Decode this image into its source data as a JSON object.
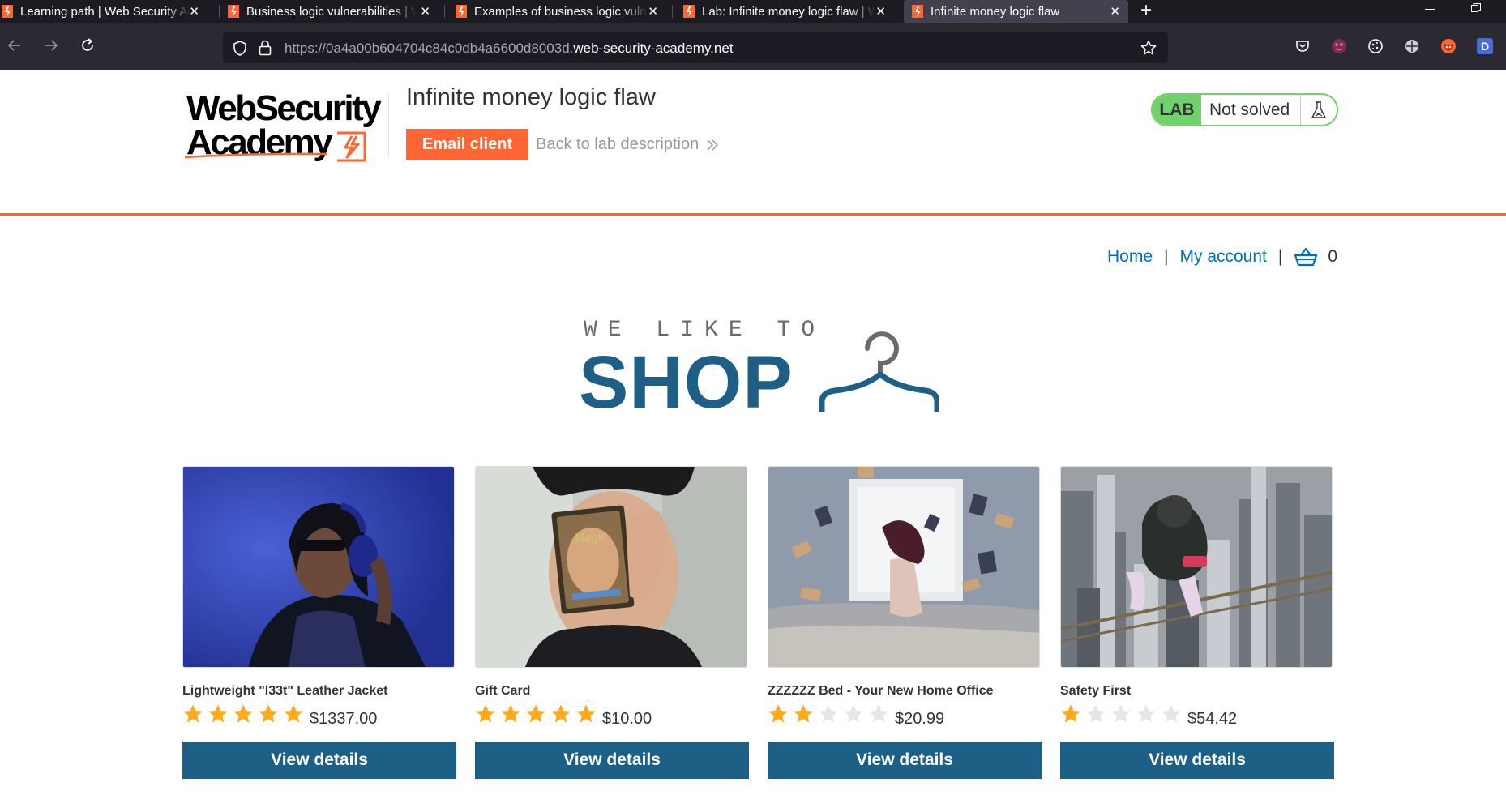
{
  "browser": {
    "tabs": [
      {
        "title": "Learning path | Web Security Academy",
        "active": false
      },
      {
        "title": "Business logic vulnerabilities | Web Security Academy",
        "active": false
      },
      {
        "title": "Examples of business logic vulnerabilities",
        "active": false
      },
      {
        "title": "Lab: Infinite money logic flaw | Web Security Academy",
        "active": false
      },
      {
        "title": "Infinite money logic flaw",
        "active": true
      }
    ],
    "url": {
      "prefix": "https://0a4a00b604704c84c0db4a6600d8003d.",
      "domain": "web-security-academy.net"
    },
    "extension_icons": [
      "pocket-icon",
      "extension-icon",
      "cookie-icon",
      "extension-icon",
      "fox-extension-icon",
      "d-extension-icon"
    ],
    "colors": {
      "tabbar": "#1c1b22",
      "toolbar": "#2b2a33",
      "active_tab": "#42414d"
    }
  },
  "header": {
    "logo": {
      "line1": "WebSecurity",
      "line2": "Academy"
    },
    "lab_title": "Infinite money logic flaw",
    "email_client_label": "Email client",
    "back_link_label": "Back to lab description",
    "status": {
      "badge": "LAB",
      "state": "Not solved"
    },
    "colors": {
      "accent": "#ff6633",
      "solved_green": "#70d16d"
    }
  },
  "nav": {
    "home_label": "Home",
    "separator": "|",
    "account_label": "My account",
    "cart_count": "0"
  },
  "banner": {
    "tagline": "WE LIKE TO",
    "headline": "SHOP",
    "color": "#1e5f86"
  },
  "products": [
    {
      "name": "Lightweight \"l33t\" Leather Jacket",
      "price": "$1337.00",
      "rating": 5,
      "button_label": "View details",
      "image": "woman-headphones-photo"
    },
    {
      "name": "Gift Card",
      "price": "$10.00",
      "rating": 5,
      "button_label": "View details",
      "image": "magic-card-photo"
    },
    {
      "name": "ZZZZZZ Bed - Your New Home Office",
      "price": "$20.99",
      "rating": 2,
      "button_label": "View details",
      "image": "flying-books-bed-photo"
    },
    {
      "name": "Safety First",
      "price": "$54.42",
      "rating": 1,
      "button_label": "View details",
      "image": "tightrope-city-photo"
    }
  ]
}
